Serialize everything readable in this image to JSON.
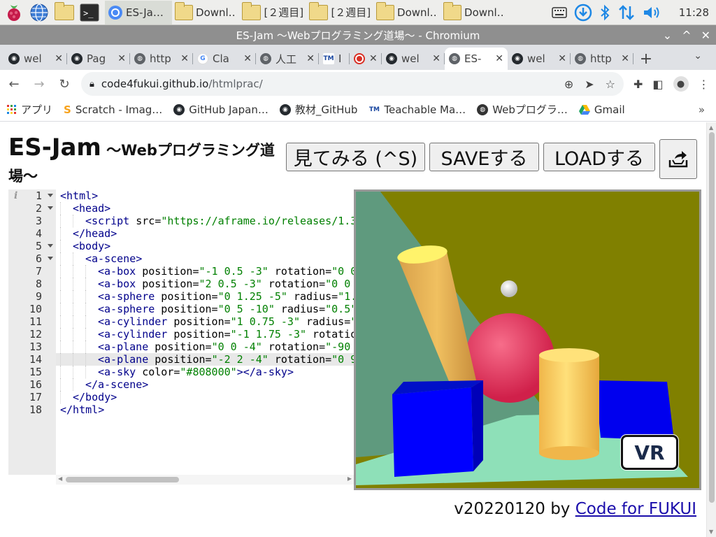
{
  "taskbar": {
    "tasks": [
      {
        "label": "ES-Ja…",
        "icon": "chromium-icon",
        "active": true
      },
      {
        "label": "Downl…",
        "icon": "folder-icon"
      },
      {
        "label": "[２週目]",
        "icon": "folder-icon"
      },
      {
        "label": "[２週目]",
        "icon": "folder-icon"
      },
      {
        "label": "Downl…",
        "icon": "folder-icon"
      },
      {
        "label": "Downl…",
        "icon": "folder-icon"
      }
    ],
    "clock": "11:28"
  },
  "window": {
    "title": "ES-Jam 〜Webプログラミング道場〜 - Chromium"
  },
  "tabs": [
    {
      "label": "wel",
      "icon": "github-icon"
    },
    {
      "label": "Pag",
      "icon": "github-icon"
    },
    {
      "label": "http",
      "icon": "globe-icon"
    },
    {
      "label": "Cla",
      "icon": "google-icon"
    },
    {
      "label": "人工",
      "icon": "globe-icon"
    },
    {
      "label": "I",
      "icon": "teachable-icon"
    },
    {
      "label": "",
      "icon": "record-icon"
    },
    {
      "label": "wel",
      "icon": "github-icon"
    },
    {
      "label": "ES-",
      "icon": "globe-icon",
      "active": true
    },
    {
      "label": "wel",
      "icon": "github-icon"
    },
    {
      "label": "http",
      "icon": "globe-icon"
    }
  ],
  "address": {
    "host": "code4fukui.github.io",
    "path": "/htmlprac/"
  },
  "bookmarks": [
    {
      "label": "アプリ",
      "icon": "apps-icon"
    },
    {
      "label": "Scratch - Imag…",
      "icon": "scratch-icon"
    },
    {
      "label": "GitHub Japan…",
      "icon": "github-icon"
    },
    {
      "label": "教材_GitHub",
      "icon": "github-icon"
    },
    {
      "label": "Teachable Ma…",
      "icon": "teachable-icon"
    },
    {
      "label": "Webプログラ…",
      "icon": "globe-icon"
    },
    {
      "label": "Gmail",
      "icon": "drive-icon"
    }
  ],
  "page": {
    "title_main": "ES-Jam",
    "title_sub": "〜Webプログラミング道場〜",
    "buttons": {
      "view": "見てみる (^S)",
      "save": "SAVEする",
      "load": "LOADする"
    },
    "vr_label": "VR",
    "footer_text": "v20220120 by ",
    "footer_link": "Code for FUKUI"
  },
  "editor": {
    "active_line": 14,
    "lines": [
      {
        "n": "1",
        "fold": true
      },
      {
        "n": "2",
        "fold": true
      },
      {
        "n": "3"
      },
      {
        "n": "4"
      },
      {
        "n": "5",
        "fold": true
      },
      {
        "n": "6",
        "fold": true
      },
      {
        "n": "7"
      },
      {
        "n": "8"
      },
      {
        "n": "9"
      },
      {
        "n": "10"
      },
      {
        "n": "11"
      },
      {
        "n": "12"
      },
      {
        "n": "13"
      },
      {
        "n": "14"
      },
      {
        "n": "15"
      },
      {
        "n": "16"
      },
      {
        "n": "17"
      },
      {
        "n": "18"
      }
    ],
    "code": [
      "<html>",
      "  <head>",
      "    <script src=\"https://aframe.io/releases/1.3",
      "  </head>",
      "  <body>",
      "    <a-scene>",
      "      <a-box position=\"-1 0.5 -3\" rotation=\"0 0",
      "      <a-box position=\"2 0.5 -3\" rotation=\"0 0 ",
      "      <a-sphere position=\"0 1.25 -5\" radius=\"1.",
      "      <a-sphere position=\"0 5 -10\" radius=\"0.5\"",
      "      <a-cylinder position=\"1 0.75 -3\" radius=\"",
      "      <a-cylinder position=\"-1 1.75 -3\" rotatio",
      "      <a-plane position=\"0 0 -4\" rotation=\"-90 ",
      "      <a-plane position=\"-2 2 -4\" rotation=\"0 9",
      "      <a-sky color=\"#808000\"></a-sky>",
      "    </a-scene>",
      "  </body>",
      "</html>"
    ]
  },
  "colors": {
    "sky": "#808000",
    "box": "#0000ff",
    "sphere": "#e8365d",
    "cylinder": "#f5c85a",
    "plane_floor": "#8ee0b8",
    "plane_wall": "#5f9a7e",
    "link": "#1a0dab"
  }
}
